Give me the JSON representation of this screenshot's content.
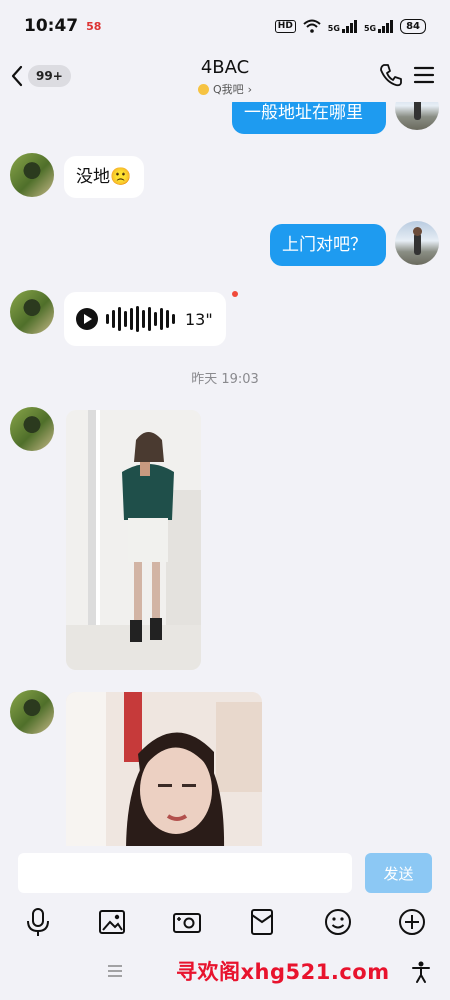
{
  "status_bar": {
    "time": "10:47",
    "app_badge": "58",
    "hd": "HD",
    "net1": "5G",
    "net2": "5G",
    "battery": "84"
  },
  "nav": {
    "unread_count": "99+",
    "title": "4BAC",
    "subtitle": "Q我吧",
    "subtitle_chevron": "›"
  },
  "messages": [
    {
      "side": "out",
      "text": "一般地址在哪里"
    },
    {
      "side": "in",
      "text": "没地🙁"
    },
    {
      "side": "out",
      "text": "上门对吧？"
    },
    {
      "side": "in",
      "type": "voice",
      "duration": "13\""
    }
  ],
  "timestamp": "昨天 19:03",
  "composer": {
    "input_value": "",
    "send_label": "发送"
  },
  "toolbar_icons": [
    "microphone-icon",
    "image-icon",
    "camera-icon",
    "red-packet-icon",
    "emoji-icon",
    "plus-icon"
  ],
  "watermark": "寻欢阁xhg521.com",
  "colors": {
    "outgoing_bubble": "#1e9bf0",
    "send_button": "#8cc8f4",
    "unread_dot": "#f04a3a",
    "watermark": "#e8132d"
  }
}
